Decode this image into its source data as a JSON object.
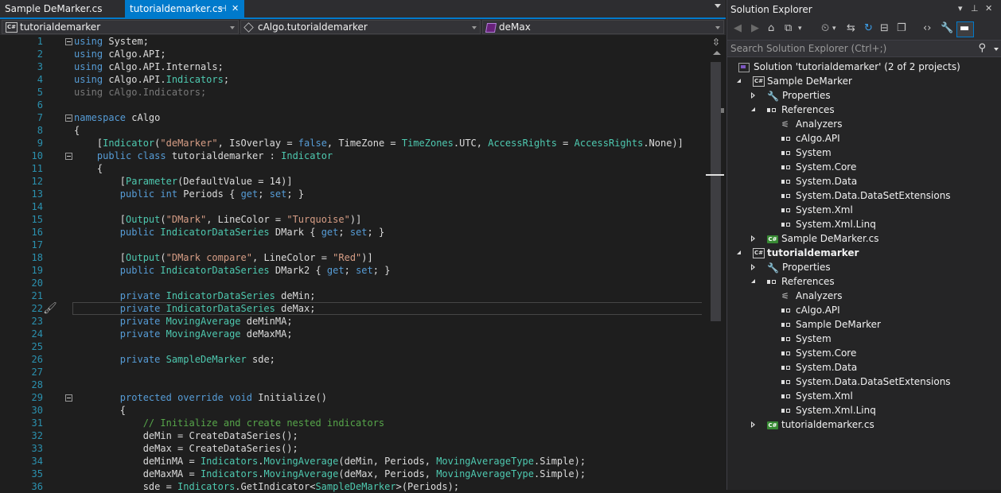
{
  "tabs": [
    {
      "label": "Sample DeMarker.cs",
      "active": false
    },
    {
      "label": "tutorialdemarker.cs",
      "active": true,
      "pin_icon": "pin-icon",
      "close_icon": "close-icon"
    }
  ],
  "nav": {
    "project": "tutorialdemarker",
    "type": "cAlgo.tutorialdemarker",
    "member": "deMax"
  },
  "editor": {
    "lines": [
      {
        "n": "1"
      },
      {
        "n": "2"
      },
      {
        "n": "3"
      },
      {
        "n": "4"
      },
      {
        "n": "5"
      },
      {
        "n": "6"
      },
      {
        "n": "7"
      },
      {
        "n": "8"
      },
      {
        "n": "9"
      },
      {
        "n": "10"
      },
      {
        "n": "11"
      },
      {
        "n": "12"
      },
      {
        "n": "13"
      },
      {
        "n": "14"
      },
      {
        "n": "15"
      },
      {
        "n": "16"
      },
      {
        "n": "17"
      },
      {
        "n": "18"
      },
      {
        "n": "19"
      },
      {
        "n": "20"
      },
      {
        "n": "21"
      },
      {
        "n": "22"
      },
      {
        "n": "23"
      },
      {
        "n": "24"
      },
      {
        "n": "25"
      },
      {
        "n": "26"
      },
      {
        "n": "27"
      },
      {
        "n": "28"
      },
      {
        "n": "29"
      },
      {
        "n": "30"
      },
      {
        "n": "31"
      },
      {
        "n": "32"
      },
      {
        "n": "33"
      },
      {
        "n": "34"
      },
      {
        "n": "35"
      },
      {
        "n": "36"
      }
    ],
    "code": {
      "l1": "using System;",
      "l2": "using cAlgo.API;",
      "l3": "using cAlgo.API.Internals;",
      "l4": "using cAlgo.API.Indicators;",
      "l5": "using cAlgo.Indicators;",
      "l7": "namespace cAlgo",
      "l8": "{",
      "l9": "    [Indicator(\"deMarker\", IsOverlay = false, TimeZone = TimeZones.UTC, AccessRights = AccessRights.None)]",
      "l10": "    public class tutorialdemarker : Indicator",
      "l11": "    {",
      "l12": "        [Parameter(DefaultValue = 14)]",
      "l13": "        public int Periods { get; set; }",
      "l15": "        [Output(\"DMark\", LineColor = \"Turquoise\")]",
      "l16": "        public IndicatorDataSeries DMark { get; set; }",
      "l18": "        [Output(\"DMark compare\", LineColor = \"Red\")]",
      "l19": "        public IndicatorDataSeries DMark2 { get; set; }",
      "l21": "        private IndicatorDataSeries deMin;",
      "l22": "        private IndicatorDataSeries deMax;",
      "l23": "        private MovingAverage deMinMA;",
      "l24": "        private MovingAverage deMaxMA;",
      "l26": "        private SampleDeMarker sde;",
      "l29": "        protected override void Initialize()",
      "l30": "        {",
      "l31": "            // Initialize and create nested indicators",
      "l32": "            deMin = CreateDataSeries();",
      "l33": "            deMax = CreateDataSeries();",
      "l34": "            deMinMA = Indicators.MovingAverage(deMin, Periods, MovingAverageType.Simple);",
      "l35": "            deMaxMA = Indicators.MovingAverage(deMax, Periods, MovingAverageType.Simple);",
      "l36": "            sde = Indicators.GetIndicator<SampleDeMarker>(Periods);"
    }
  },
  "solution_explorer": {
    "title": "Solution Explorer",
    "search_placeholder": "Search Solution Explorer (Ctrl+;)",
    "solution": "Solution 'tutorialdemarker' (2 of 2 projects)",
    "project1": {
      "name": "Sample DeMarker",
      "properties": "Properties",
      "references": "References",
      "refs": [
        "Analyzers",
        "cAlgo.API",
        "System",
        "System.Core",
        "System.Data",
        "System.Data.DataSetExtensions",
        "System.Xml",
        "System.Xml.Linq"
      ],
      "file": "Sample DeMarker.cs"
    },
    "project2": {
      "name": "tutorialdemarker",
      "properties": "Properties",
      "references": "References",
      "refs": [
        "Analyzers",
        "cAlgo.API",
        "Sample DeMarker",
        "System",
        "System.Core",
        "System.Data",
        "System.Data.DataSetExtensions",
        "System.Xml",
        "System.Xml.Linq"
      ],
      "file": "tutorialdemarker.cs"
    }
  },
  "colors": {
    "accent": "#007acc",
    "keyword": "#569cd6",
    "type": "#4ec9b0",
    "string": "#d69d85",
    "comment": "#57a64a",
    "line_number": "#2b91af"
  }
}
